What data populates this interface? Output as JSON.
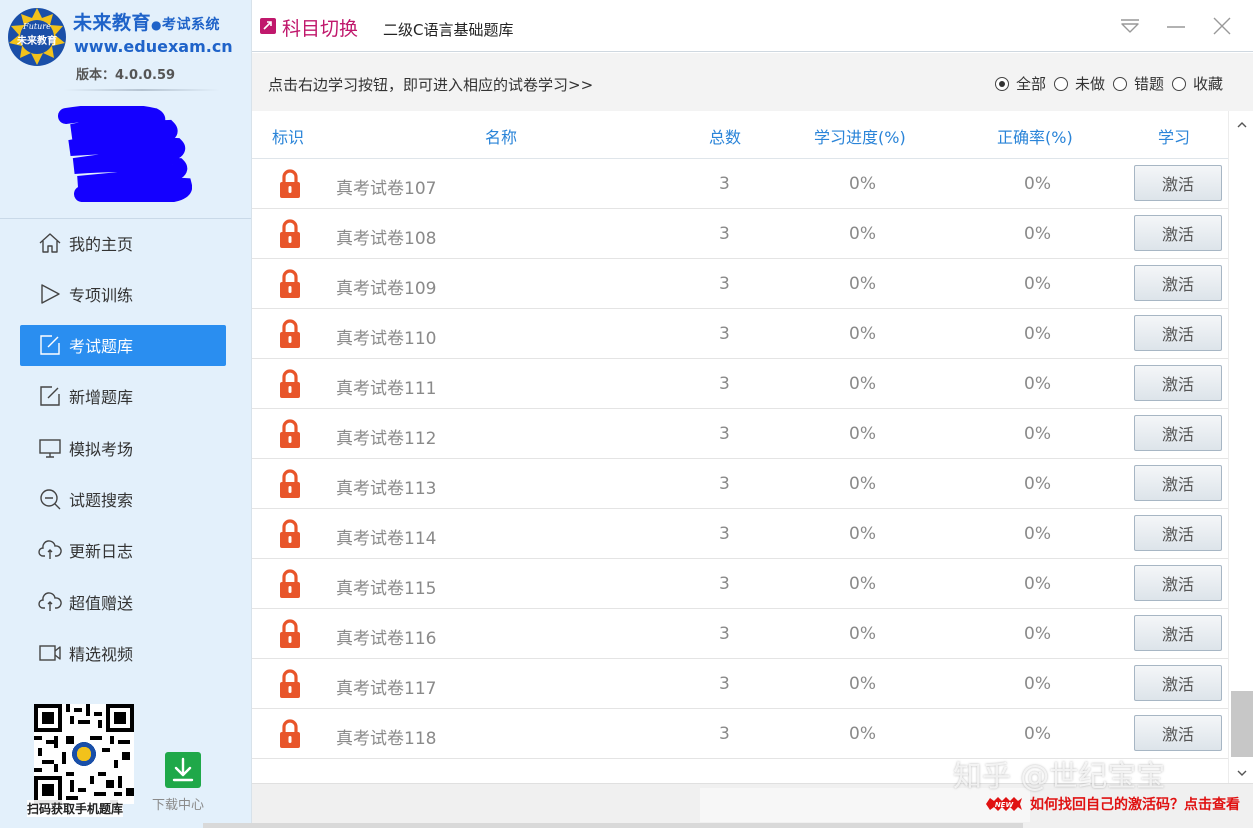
{
  "brand": {
    "name": "未来教育",
    "separator": "●",
    "subtitle": "考试系统",
    "url": "www.eduexam.cn",
    "version": "版本：4.0.0.59",
    "logo_text_top": "Future",
    "logo_text_main": "未来教育"
  },
  "sidebar": {
    "items": [
      {
        "label": "我的主页",
        "icon": "home-icon"
      },
      {
        "label": "专项训练",
        "icon": "play-icon"
      },
      {
        "label": "考试题库",
        "icon": "edit-icon",
        "active": true
      },
      {
        "label": "新增题库",
        "icon": "edit-icon"
      },
      {
        "label": "模拟考场",
        "icon": "monitor-icon"
      },
      {
        "label": "试题搜索",
        "icon": "search-icon"
      },
      {
        "label": "更新日志",
        "icon": "cloud-sync-icon"
      },
      {
        "label": "超值赠送",
        "icon": "cloud-sync-icon"
      },
      {
        "label": "精选视频",
        "icon": "video-icon"
      }
    ],
    "qr_caption": "扫码获取手机题库",
    "download_label": "下载中心"
  },
  "titlebar": {
    "switch_label": "科目切换",
    "subject": "二级C语言基础题库"
  },
  "toolbar": {
    "hint": "点击右边学习按钮，即可进入相应的试卷学习>>",
    "filters": [
      {
        "label": "全部",
        "checked": true
      },
      {
        "label": "未做",
        "checked": false
      },
      {
        "label": "错题",
        "checked": false
      },
      {
        "label": "收藏",
        "checked": false
      }
    ]
  },
  "table": {
    "headers": {
      "mark": "标识",
      "name": "名称",
      "total": "总数",
      "progress": "学习进度(%)",
      "accuracy": "正确率(%)",
      "study": "学习"
    },
    "rows": [
      {
        "name": "真考试卷107",
        "total": "3",
        "progress": "0%",
        "accuracy": "0%",
        "action": "激活"
      },
      {
        "name": "真考试卷108",
        "total": "3",
        "progress": "0%",
        "accuracy": "0%",
        "action": "激活"
      },
      {
        "name": "真考试卷109",
        "total": "3",
        "progress": "0%",
        "accuracy": "0%",
        "action": "激活"
      },
      {
        "name": "真考试卷110",
        "total": "3",
        "progress": "0%",
        "accuracy": "0%",
        "action": "激活"
      },
      {
        "name": "真考试卷111",
        "total": "3",
        "progress": "0%",
        "accuracy": "0%",
        "action": "激活"
      },
      {
        "name": "真考试卷112",
        "total": "3",
        "progress": "0%",
        "accuracy": "0%",
        "action": "激活"
      },
      {
        "name": "真考试卷113",
        "total": "3",
        "progress": "0%",
        "accuracy": "0%",
        "action": "激活"
      },
      {
        "name": "真考试卷114",
        "total": "3",
        "progress": "0%",
        "accuracy": "0%",
        "action": "激活"
      },
      {
        "name": "真考试卷115",
        "total": "3",
        "progress": "0%",
        "accuracy": "0%",
        "action": "激活"
      },
      {
        "name": "真考试卷116",
        "total": "3",
        "progress": "0%",
        "accuracy": "0%",
        "action": "激活"
      },
      {
        "name": "真考试卷117",
        "total": "3",
        "progress": "0%",
        "accuracy": "0%",
        "action": "激活"
      },
      {
        "name": "真考试卷118",
        "total": "3",
        "progress": "0%",
        "accuracy": "0%",
        "action": "激活"
      }
    ]
  },
  "footer": {
    "new_badge": "NEW",
    "notice": "如何找回自己的激活码？点击查看"
  },
  "watermark": "知乎 @世纪宝宝",
  "colors": {
    "sidebar_bg": "#e3f0fb",
    "active_nav": "#2a8ef0",
    "brand_blue": "#1f63c9",
    "switch_magenta": "#c0186c",
    "header_blue": "#2a84d8",
    "lock_orange": "#e8552a",
    "notice_red": "#e01212",
    "download_green": "#1fa849"
  }
}
